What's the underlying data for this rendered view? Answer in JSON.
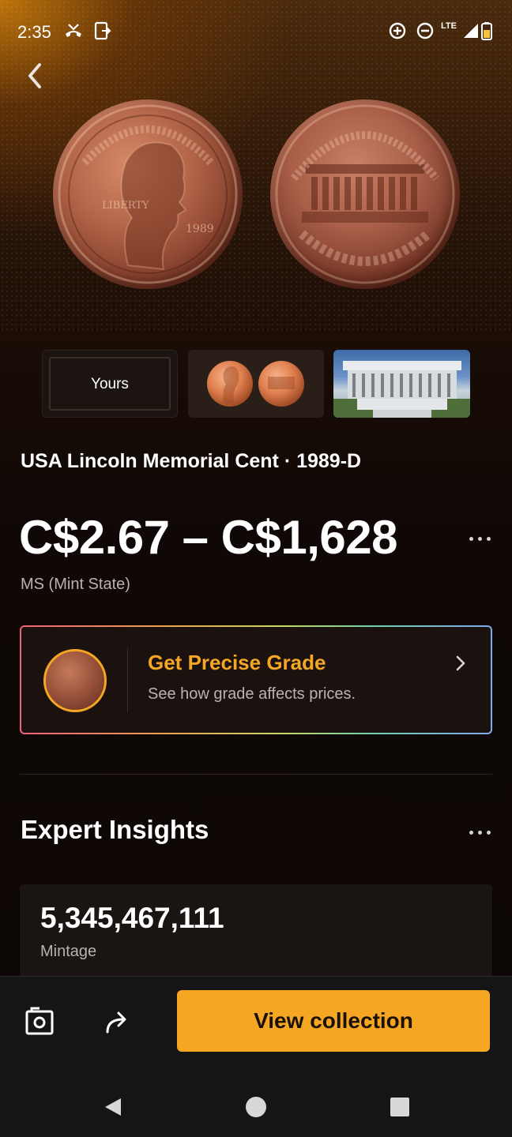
{
  "status_bar": {
    "time": "2:35",
    "network": "LTE",
    "icons": [
      "missed-call-icon",
      "screenshot-icon",
      "data-saver-icon",
      "do-not-disturb-icon",
      "signal-icon",
      "battery-icon"
    ]
  },
  "thumbnails": [
    {
      "label": "Yours"
    },
    {
      "label": ""
    },
    {
      "label": ""
    }
  ],
  "coin": {
    "title": "USA Lincoln Memorial Cent · 1989-D",
    "price_range": "C$2.67 – C$1,628",
    "grade": "MS (Mint State)"
  },
  "grade_card": {
    "title": "Get Precise Grade",
    "subtitle": "See how grade affects prices."
  },
  "insights": {
    "title": "Expert Insights",
    "mintage_value": "5,345,467,111",
    "mintage_label": "Mintage"
  },
  "bottom_bar": {
    "primary_label": "View collection"
  },
  "colors": {
    "accent": "#f5a623",
    "background": "#0d0806",
    "card": "#1b1210"
  }
}
